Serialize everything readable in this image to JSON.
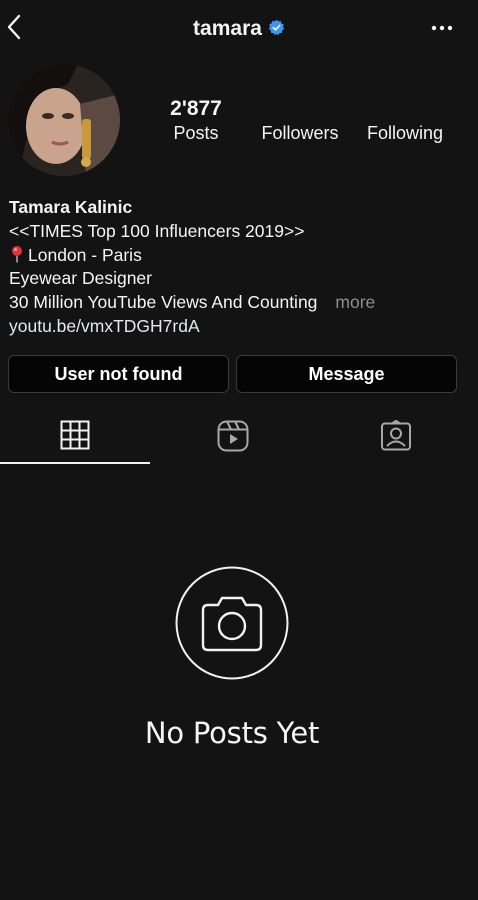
{
  "header": {
    "username": "tamara",
    "back_icon": "chevron-left-icon",
    "verified_icon": "verified-badge-icon",
    "more_icon": "more-horizontal-icon",
    "verified_color": "#3897f0"
  },
  "profile": {
    "stats": {
      "posts_count": "2'877",
      "posts_label": "Posts",
      "followers_count": "",
      "followers_label": "Followers",
      "following_count": "",
      "following_label": "Following"
    },
    "bio": {
      "name": "Tamara Kalinic",
      "line1": "<<TIMES Top 100 Influencers 2019>>",
      "line2_icon": "pin-icon",
      "line2_text": "London - Paris",
      "line3": "Eyewear Designer",
      "line4": "30 Million YouTube Views And Counting",
      "more_label": "more",
      "link": "youtu.be/vmxTDGH7rdA"
    }
  },
  "actions": {
    "primary_label": "User not found",
    "message_label": "Message"
  },
  "tabs": {
    "grid_icon": "grid-icon",
    "reels_icon": "reels-icon",
    "tagged_icon": "tagged-icon",
    "active": "grid"
  },
  "empty_state": {
    "icon": "camera-icon",
    "text": "No Posts Yet"
  },
  "theme": {
    "background": "#131313",
    "text": "#f5f5f5",
    "muted": "#8e8e8e"
  }
}
